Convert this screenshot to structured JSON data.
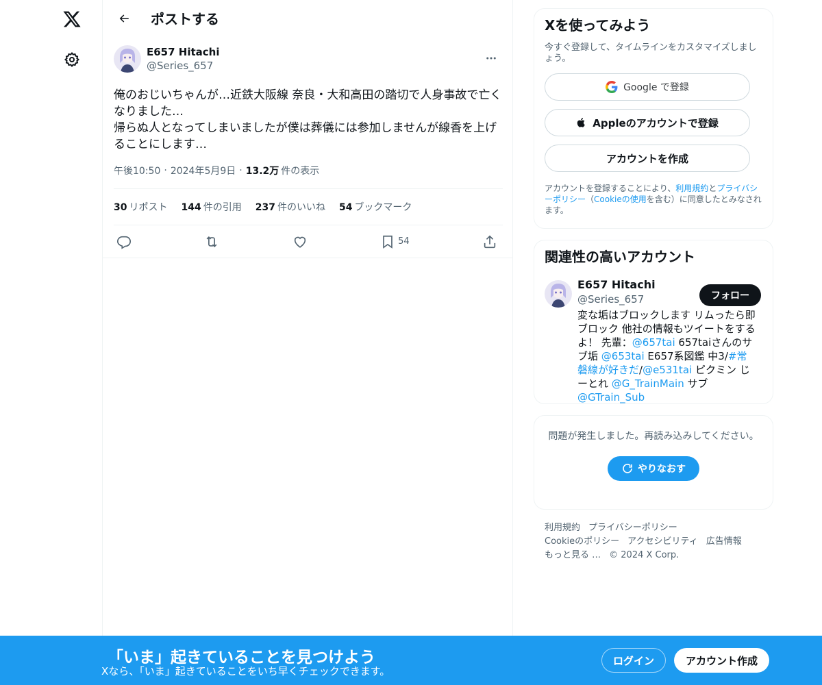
{
  "header": {
    "title": "ポストする"
  },
  "post": {
    "author_name": "E657 Hitachi",
    "author_handle": "@Series_657",
    "text": "俺のおじいちゃんが…近鉄大阪線 奈良・大和高田の踏切で人身事故で亡く\nなりました…\n帰らぬ人となってしまいましたが僕は葬儀には参加しませんが線香を上げ\nることにします…",
    "time": "午後10:50",
    "date": "2024年5月9日",
    "views_count": "13.2万",
    "views_label": "件の表示",
    "stats": [
      {
        "count": "30",
        "label": "リポスト"
      },
      {
        "count": "144",
        "label": "件の引用"
      },
      {
        "count": "237",
        "label": "件のいいね"
      },
      {
        "count": "54",
        "label": "ブックマーク"
      }
    ],
    "bookmark_count": "54"
  },
  "signup": {
    "title": "Xを使ってみよう",
    "subtitle": "今すぐ登録して、タイムラインをカスタマイズしましょう。",
    "google_label": "Google で登録",
    "apple_label": "Appleのアカウントで登録",
    "create_label": "アカウントを作成",
    "terms_prefix": "アカウントを登録することにより、",
    "terms_link": "利用規約",
    "terms_and": "と",
    "privacy_link": "プライバシーポリシー",
    "terms_paren_open": "（",
    "cookie_link": "Cookieの使用",
    "terms_suffix": "を含む）に同意したとみなされます。"
  },
  "related": {
    "title": "関連性の高いアカウント",
    "name": "E657 Hitachi",
    "handle": "@Series_657",
    "follow_label": "フォロー",
    "bio": [
      {
        "t": "変な垢はブロックします リムったら即ブロック 他社の情報もツイートをするよ！ 先輩："
      },
      {
        "t": "@657tai",
        "link": true
      },
      {
        "t": " 657taiさんのサブ垢 "
      },
      {
        "t": "@653tai",
        "link": true
      },
      {
        "t": " E657系図鑑 中3/"
      },
      {
        "t": "#常磐線が好きだ",
        "link": true
      },
      {
        "t": "/"
      },
      {
        "t": "@e531tai",
        "link": true
      },
      {
        "t": " ピクミン じーとれ "
      },
      {
        "t": "@G_TrainMain",
        "link": true
      },
      {
        "t": " サブ "
      },
      {
        "t": "@GTrain_Sub",
        "link": true
      }
    ]
  },
  "error": {
    "text": "問題が発生しました。再読み込みしてください。",
    "retry_label": "やりなおす"
  },
  "footer": {
    "links": [
      "利用規約",
      "プライバシーポリシー",
      "Cookieのポリシー",
      "アクセシビリティ",
      "広告情報",
      "もっと見る …"
    ],
    "copyright": "© 2024 X Corp."
  },
  "banner": {
    "title": "「いま」起きていることを見つけよう",
    "subtitle": "Xなら、「いま」起きていることをいち早くチェックできます。",
    "login_label": "ログイン",
    "signup_label": "アカウント作成"
  },
  "colors": {
    "accent": "#1d9bf0",
    "text": "#0f1419",
    "muted": "#536471",
    "border": "#eff3f4"
  },
  "icons": {
    "logo": "x-logo-icon",
    "settings": "gear-icon",
    "back": "arrow-left-icon",
    "more": "more-horizontal-icon",
    "reply": "reply-icon",
    "repost": "repost-icon",
    "like": "heart-icon",
    "bookmark": "bookmark-icon",
    "share": "share-icon",
    "google": "google-icon",
    "apple": "apple-icon",
    "retry": "refresh-icon"
  }
}
